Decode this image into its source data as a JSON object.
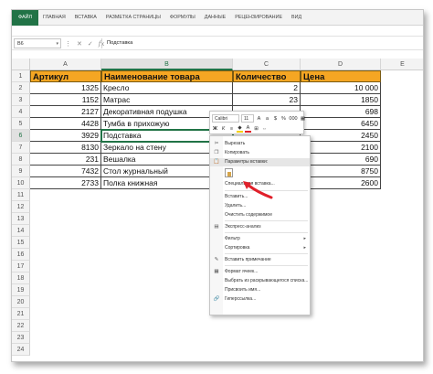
{
  "ribbon": {
    "tabs": [
      "ФАЙЛ",
      "ГЛАВНАЯ",
      "ВСТАВКА",
      "РАЗМЕТКА СТРАНИЦЫ",
      "ФОРМУЛЫ",
      "ДАННЫЕ",
      "РЕЦЕНЗИРОВАНИЕ",
      "ВИД"
    ]
  },
  "formula_bar": {
    "name_box": "B6",
    "cancel_icon": "✕",
    "enter_icon": "✓",
    "fx": "fx",
    "content": "Подставка"
  },
  "columns": [
    "A",
    "B",
    "C",
    "D",
    "E"
  ],
  "rows": [
    "1",
    "2",
    "3",
    "4",
    "5",
    "6",
    "7",
    "8",
    "9",
    "10",
    "11",
    "12",
    "13",
    "14",
    "15",
    "16",
    "17",
    "18",
    "19",
    "20",
    "21",
    "22",
    "23",
    "24"
  ],
  "table": {
    "headers": [
      "Артикул",
      "Наименование товара",
      "Количество",
      "Цена"
    ],
    "rows": [
      [
        "1325",
        "Кресло",
        "2",
        "10 000"
      ],
      [
        "1152",
        "Матрас",
        "23",
        "1850"
      ],
      [
        "2127",
        "Декоративная подушка",
        "",
        "698"
      ],
      [
        "4428",
        "Тумба в прихожую",
        "",
        "6450"
      ],
      [
        "3929",
        "Подставка",
        "",
        "2450"
      ],
      [
        "8130",
        "Зеркало на стену",
        "",
        "2100"
      ],
      [
        "231",
        "Вешалка",
        "",
        "690"
      ],
      [
        "7432",
        "Стол журнальный",
        "",
        "8750"
      ],
      [
        "2733",
        "Полка книжная",
        "",
        "2600"
      ]
    ]
  },
  "mini_toolbar": {
    "font": "Calibri",
    "size": "11",
    "buttons": [
      "Ж",
      "К",
      "≡",
      "A",
      "%",
      "000",
      "$",
      "▦",
      "⊞"
    ]
  },
  "context_menu": {
    "items": [
      "Вырезать",
      "Копировать",
      "Параметры вставки:",
      "Специальная вставка...",
      "Вставить...",
      "Удалить...",
      "Очистить содержимое",
      "Экспресс-анализ",
      "Фильтр",
      "Сортировка",
      "Вставить примечание",
      "Формат ячеек...",
      "Выбрать из раскрывающегося списка...",
      "Присвоить имя...",
      "Гиперссылка..."
    ]
  },
  "colors": {
    "excel_green": "#217346",
    "header_fill": "#f5a623",
    "arrow": "#e0202a"
  }
}
